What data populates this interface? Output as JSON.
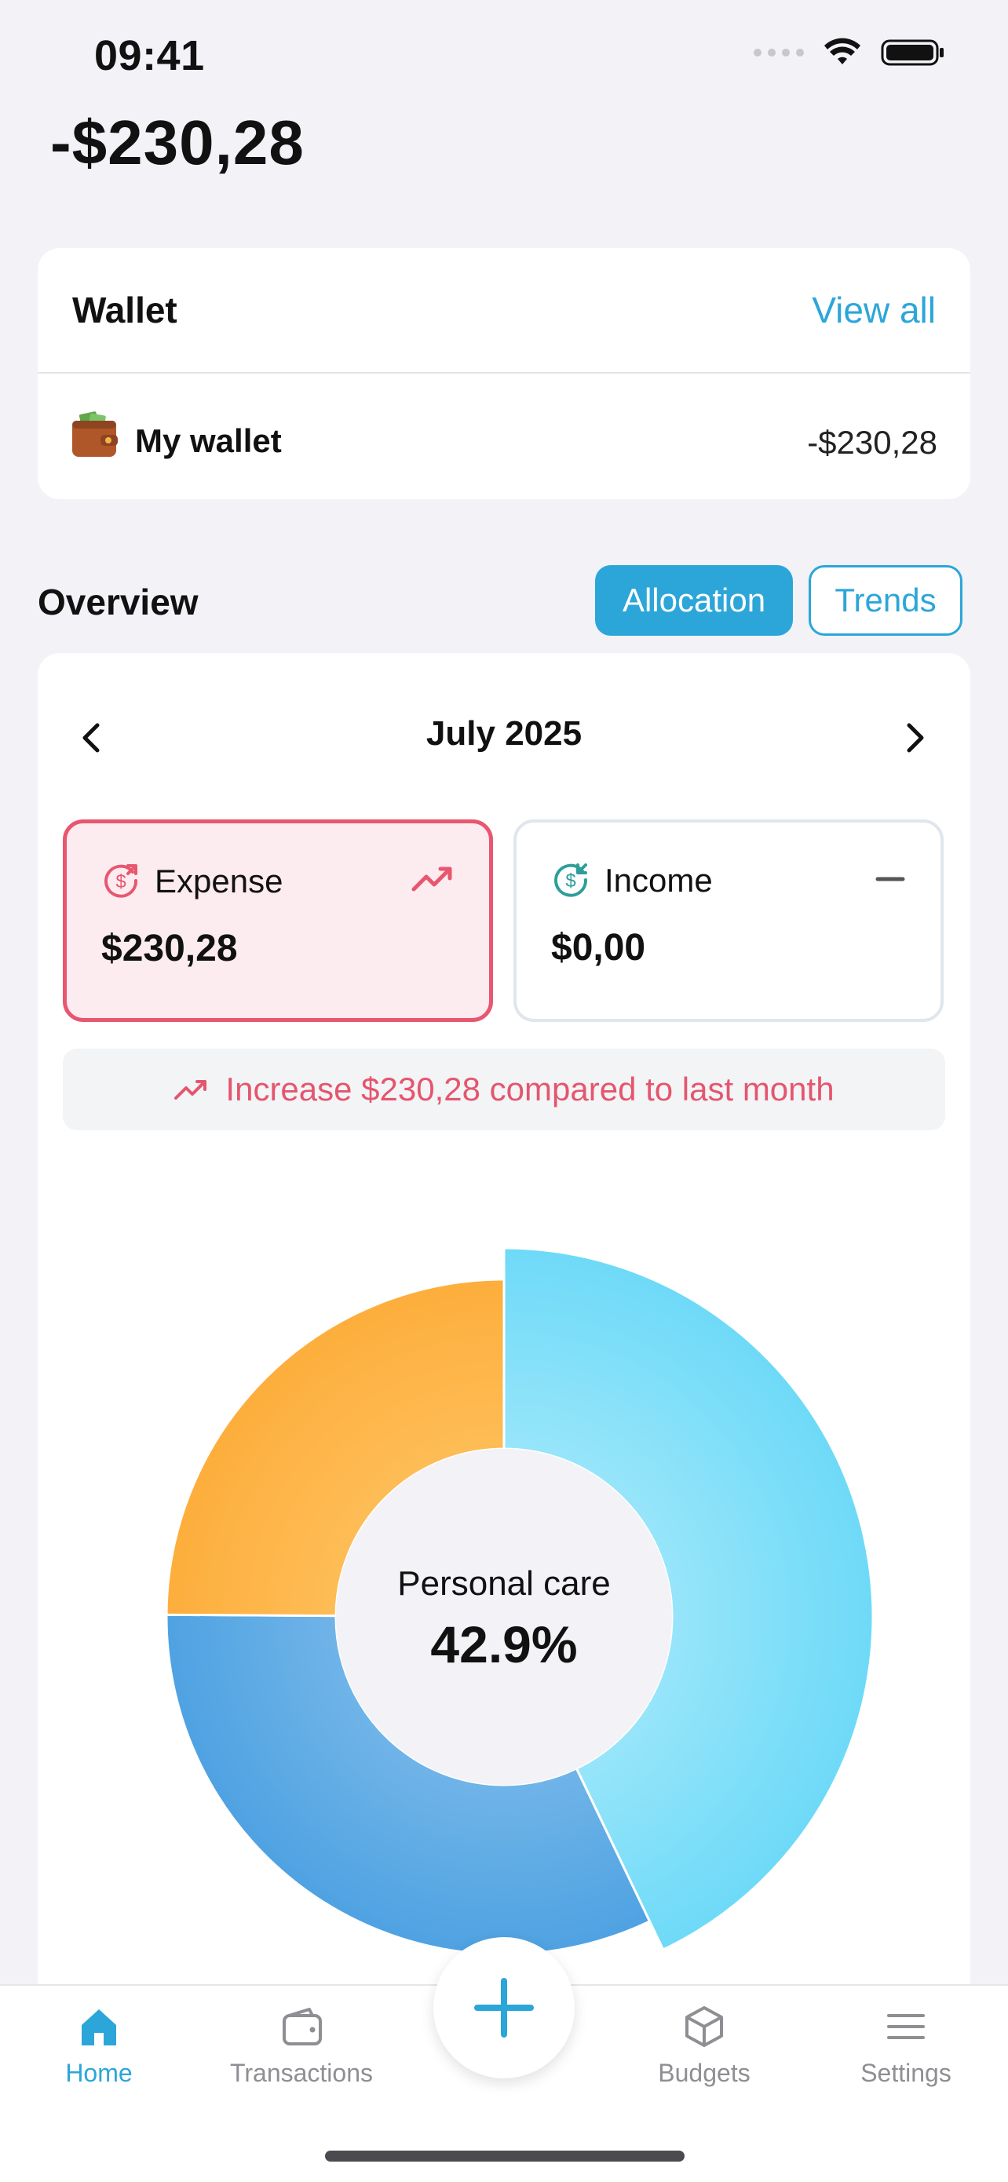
{
  "status_bar": {
    "time": "09:41"
  },
  "balance": "-$230,28",
  "wallet": {
    "title": "Wallet",
    "view_all": "View all",
    "item": {
      "name": "My wallet",
      "amount": "-$230,28",
      "icon": "wallet-icon"
    }
  },
  "overview": {
    "title": "Overview",
    "segments": [
      "Allocation",
      "Trends"
    ],
    "selected_segment": "Allocation",
    "month": "July 2025",
    "expense": {
      "label": "Expense",
      "value": "$230,28"
    },
    "income": {
      "label": "Income",
      "value": "$0,00"
    },
    "comparison": "Increase $230,28 compared to last month"
  },
  "chart_data": {
    "type": "pie",
    "center_label": "Personal care",
    "center_value": "42.9%",
    "slices": [
      {
        "value": 42.9,
        "color": "#7FDDF7",
        "highlighted": true
      },
      {
        "value": 32.2,
        "color": "#5FAAE6"
      },
      {
        "value": 24.9,
        "color": "#FDB74C"
      }
    ]
  },
  "tabbar": {
    "items": [
      {
        "label": "Home",
        "icon": "home-icon",
        "active": true
      },
      {
        "label": "Transactions",
        "icon": "wallet-icon",
        "active": false
      },
      {
        "label": "Budgets",
        "icon": "box-icon",
        "active": false
      },
      {
        "label": "Settings",
        "icon": "menu-icon",
        "active": false
      }
    ],
    "add_icon": "plus-icon"
  },
  "colors": {
    "accent": "#2CA6D9",
    "expense": "#E8566F",
    "income": "#2E9E9A"
  }
}
